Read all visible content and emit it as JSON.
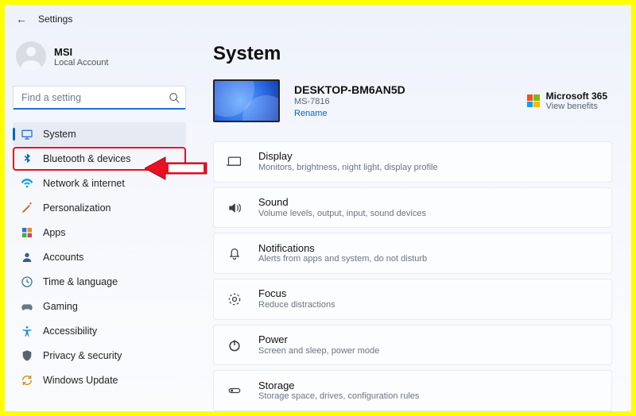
{
  "header": {
    "title": "Settings"
  },
  "user": {
    "name": "MSI",
    "subtitle": "Local Account"
  },
  "search": {
    "placeholder": "Find a setting"
  },
  "sidebar": {
    "items": [
      {
        "label": "System"
      },
      {
        "label": "Bluetooth & devices"
      },
      {
        "label": "Network & internet"
      },
      {
        "label": "Personalization"
      },
      {
        "label": "Apps"
      },
      {
        "label": "Accounts"
      },
      {
        "label": "Time & language"
      },
      {
        "label": "Gaming"
      },
      {
        "label": "Accessibility"
      },
      {
        "label": "Privacy & security"
      },
      {
        "label": "Windows Update"
      }
    ]
  },
  "page": {
    "title": "System",
    "device": {
      "name": "DESKTOP-BM6AN5D",
      "model": "MS-7816",
      "rename": "Rename"
    },
    "m365": {
      "title": "Microsoft 365",
      "sub": "View benefits"
    },
    "cards": [
      {
        "title": "Display",
        "sub": "Monitors, brightness, night light, display profile"
      },
      {
        "title": "Sound",
        "sub": "Volume levels, output, input, sound devices"
      },
      {
        "title": "Notifications",
        "sub": "Alerts from apps and system, do not disturb"
      },
      {
        "title": "Focus",
        "sub": "Reduce distractions"
      },
      {
        "title": "Power",
        "sub": "Screen and sleep, power mode"
      },
      {
        "title": "Storage",
        "sub": "Storage space, drives, configuration rules"
      }
    ]
  }
}
